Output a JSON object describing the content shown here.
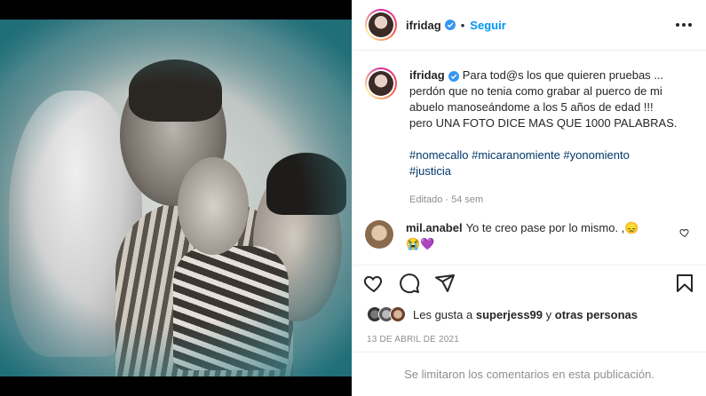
{
  "header": {
    "username": "ifridag",
    "separator": "•",
    "follow_label": "Seguir"
  },
  "caption": {
    "username": "ifridag",
    "text": "Para tod@s los que quieren pruebas ...\nperdón que no tenia como grabar al puerco de mi abuelo manoseándome a los 5 años de edad !!!\npero UNA FOTO DICE MAS QUE 1000 PALABRAS.",
    "hashtags": "#nomecallo #micaranomiente #yonomiento\n#justicia",
    "meta": "Editado · 54 sem"
  },
  "comment": {
    "username": "mil.anabel",
    "text": "Yo te creo pase por lo mismo. ,😞",
    "extra": "😭💜"
  },
  "likes": {
    "prefix": "Les gusta a",
    "user": "superjess99",
    "connector": "y",
    "others": "otras personas"
  },
  "date": "13 DE ABRIL DE 2021",
  "comments_disabled": "Se limitaron los comentarios en esta publicación.",
  "colors": {
    "link": "#0095f6",
    "hashtag": "#00376b",
    "muted": "#8e8e8e"
  },
  "icons": [
    "verified-badge-icon",
    "more-options-icon",
    "heart-icon",
    "comment-icon",
    "share-icon",
    "bookmark-icon"
  ]
}
